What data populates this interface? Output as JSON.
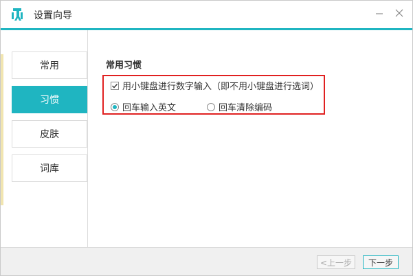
{
  "window": {
    "title": "设置向导",
    "accent_color": "#1fb5c1"
  },
  "sidebar": {
    "items": [
      {
        "label": "常用",
        "active": false
      },
      {
        "label": "习惯",
        "active": true
      },
      {
        "label": "皮肤",
        "active": false
      },
      {
        "label": "词库",
        "active": false
      }
    ]
  },
  "main": {
    "section_title": "常用习惯",
    "highlight_color": "#e02020",
    "numpad_option": {
      "label": "用小键盘进行数字输入（即不用小键盘进行选词）",
      "checked": true
    },
    "enter_options": [
      {
        "label": "回车输入英文",
        "selected": true
      },
      {
        "label": "回车清除编码",
        "selected": false
      }
    ]
  },
  "footer": {
    "prev_label": "<上一步",
    "next_label": "下一步"
  }
}
